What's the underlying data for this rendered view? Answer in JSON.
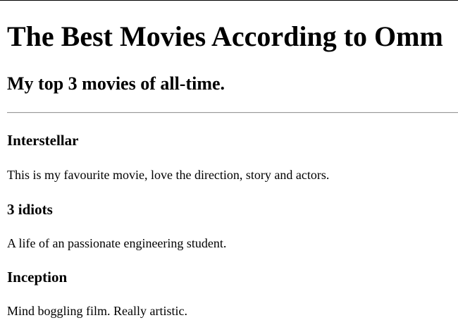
{
  "header": {
    "title": "The Best Movies According to Omm",
    "subtitle": "My top 3 movies of all-time."
  },
  "movies": [
    {
      "title": "Interstellar",
      "description": "This is my favourite movie, love the direction, story and actors."
    },
    {
      "title": "3 idiots",
      "description": "A life of an passionate engineering student."
    },
    {
      "title": "Inception",
      "description": "Mind boggling film. Really artistic."
    }
  ]
}
